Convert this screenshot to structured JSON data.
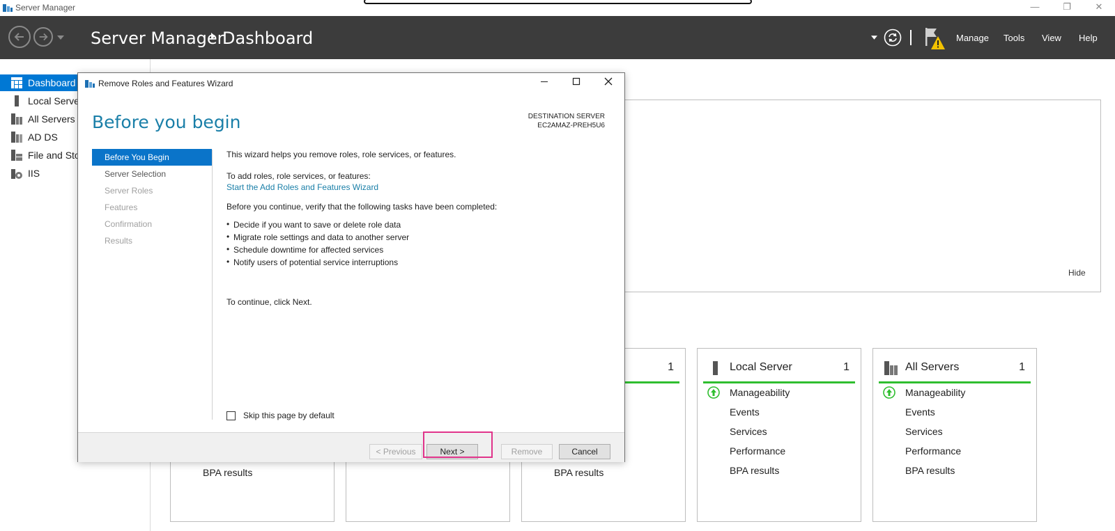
{
  "window": {
    "title": "Server Manager",
    "controls": {
      "minimize": "—",
      "restore": "❐",
      "close": "✕"
    }
  },
  "header": {
    "app": "Server Manager",
    "page": "Dashboard",
    "menu": [
      "Manage",
      "Tools",
      "View",
      "Help"
    ]
  },
  "sidebar": {
    "items": [
      {
        "label": "Dashboard",
        "icon": "dashboard-icon",
        "active": true
      },
      {
        "label": "Local Server",
        "icon": "server-icon"
      },
      {
        "label": "All Servers",
        "icon": "servers-icon"
      },
      {
        "label": "AD DS",
        "icon": "ad-ds-icon"
      },
      {
        "label": "File and Storage Services",
        "icon": "storage-icon"
      },
      {
        "label": "IIS",
        "icon": "iis-icon"
      }
    ]
  },
  "welcome": {
    "hide_label": "Hide"
  },
  "tiles": [
    {
      "name": "",
      "count": "",
      "rows": [
        "BPA results"
      ]
    },
    {
      "name": "",
      "count": "",
      "rows": []
    },
    {
      "name": "",
      "count": "1",
      "rows": [
        "BPA results"
      ]
    },
    {
      "name": "Local Server",
      "count": "1",
      "rows": [
        "Manageability",
        "Events",
        "Services",
        "Performance",
        "BPA results"
      ]
    },
    {
      "name": "All Servers",
      "count": "1",
      "rows": [
        "Manageability",
        "Events",
        "Services",
        "Performance",
        "BPA results"
      ]
    }
  ],
  "wizard": {
    "title": "Remove Roles and Features Wizard",
    "heading": "Before you begin",
    "destination_label": "DESTINATION SERVER",
    "destination_server": "EC2AMAZ-PREH5U6",
    "steps": [
      {
        "label": "Before You Begin",
        "state": "active"
      },
      {
        "label": "Server Selection",
        "state": "enabled"
      },
      {
        "label": "Server Roles",
        "state": "disabled"
      },
      {
        "label": "Features",
        "state": "disabled"
      },
      {
        "label": "Confirmation",
        "state": "disabled"
      },
      {
        "label": "Results",
        "state": "disabled"
      }
    ],
    "intro": "This wizard helps you remove roles, role services, or features.",
    "add_prompt": "To add roles, role services, or features:",
    "add_link": "Start the Add Roles and Features Wizard",
    "verify": "Before you continue, verify that the following tasks have been completed:",
    "tasks": [
      "Decide if you want to save or delete role data",
      "Migrate role settings and data to another server",
      "Schedule downtime for affected services",
      "Notify users of potential service interruptions"
    ],
    "continue": "To continue, click Next.",
    "skip_label": "Skip this page by default",
    "buttons": {
      "previous": "< Previous",
      "next": "Next >",
      "remove": "Remove",
      "cancel": "Cancel"
    }
  },
  "colors": {
    "accent": "#0078d4",
    "heading": "#1a7fa8",
    "ok": "#2fbe2f",
    "highlight": "#e0338a",
    "header_bg": "#3c3c3c"
  }
}
